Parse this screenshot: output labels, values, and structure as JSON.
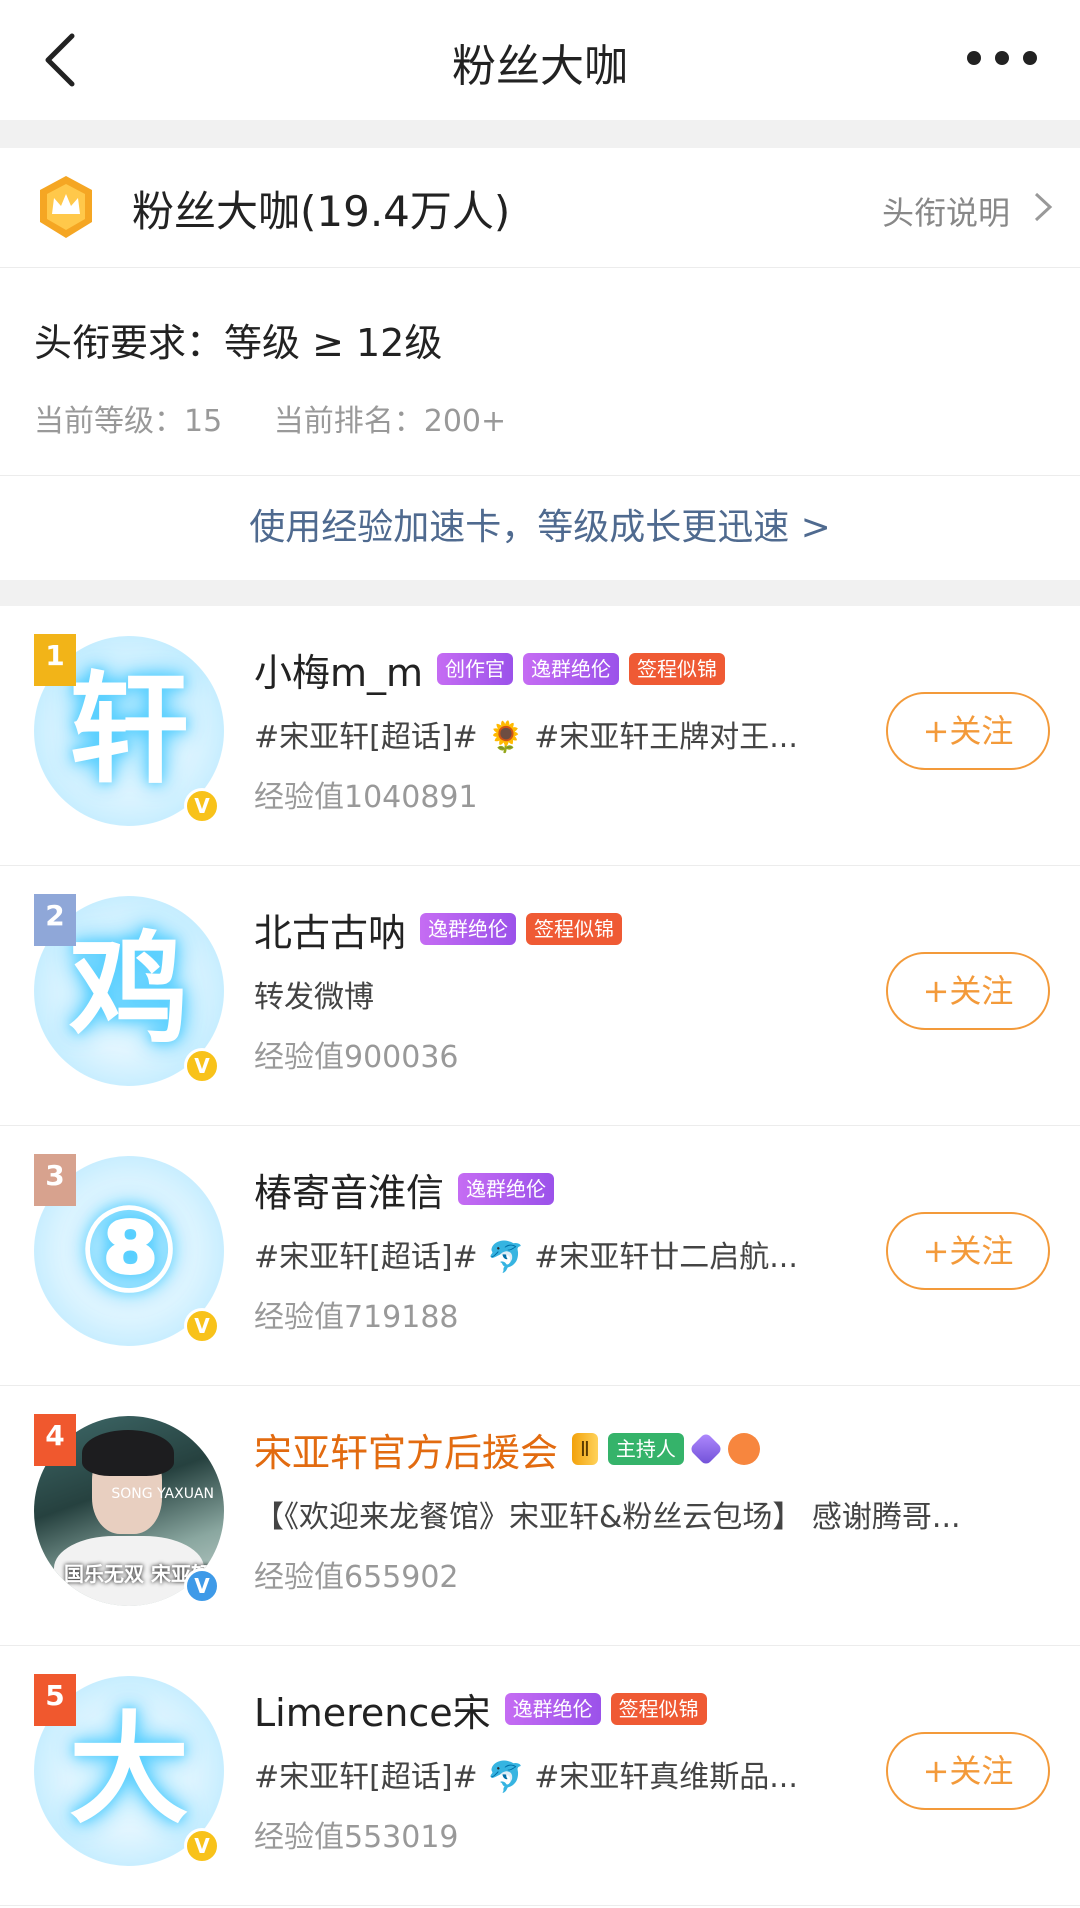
{
  "nav": {
    "title": "粉丝大咖"
  },
  "title_row": {
    "title": "粉丝大咖(19.4万人)",
    "explain": "头衔说明"
  },
  "requirement": {
    "title": "头衔要求：等级 ≥ 12级",
    "current_level": "当前等级：15",
    "current_rank": "当前排名：200+"
  },
  "speed_link": "使用经验加速卡，等级成长更迅速 >",
  "follow_label": "+关注",
  "users": [
    {
      "rank": "1",
      "avatar_char": "轩",
      "name": "小梅m_m",
      "tags": [
        "创作官",
        "逸群绝伦",
        "签程似锦"
      ],
      "desc": "#宋亚轩[超话]# 🌻 #宋亚轩王牌对王...",
      "exp": "经验值1040891",
      "verified": "V"
    },
    {
      "rank": "2",
      "avatar_char": "鸡",
      "name": "北古古呐",
      "tags": [
        "逸群绝伦",
        "签程似锦"
      ],
      "desc": "转发微博",
      "exp": "经验值900036",
      "verified": "V"
    },
    {
      "rank": "3",
      "avatar_char": "⑧",
      "name": "椿寄音淮信",
      "tags": [
        "逸群绝伦"
      ],
      "desc": "#宋亚轩[超话]# 🐬 #宋亚轩廿二启航...",
      "exp": "经验值719188",
      "verified": "V"
    },
    {
      "rank": "4",
      "name": "宋亚轩官方后援会",
      "tags": [
        "Ⅱ",
        "主持人"
      ],
      "desc": "【《欢迎来龙餐馆》宋亚轩&粉丝云包场】 感谢腾哥...",
      "exp": "经验值655902",
      "verified": "V",
      "photo_text": "国乐无双 宋亚轩",
      "photo_text2": "SONG YAXUAN"
    },
    {
      "rank": "5",
      "avatar_char": "大",
      "name": "Limerence宋",
      "tags": [
        "逸群绝伦",
        "签程似锦"
      ],
      "desc": "#宋亚轩[超话]# 🐬 #宋亚轩真维斯品...",
      "exp": "经验值553019",
      "verified": "V"
    }
  ],
  "colors": {
    "accent": "#f39a3a",
    "link": "#4f6a8f",
    "orange_name": "#e26b10"
  }
}
